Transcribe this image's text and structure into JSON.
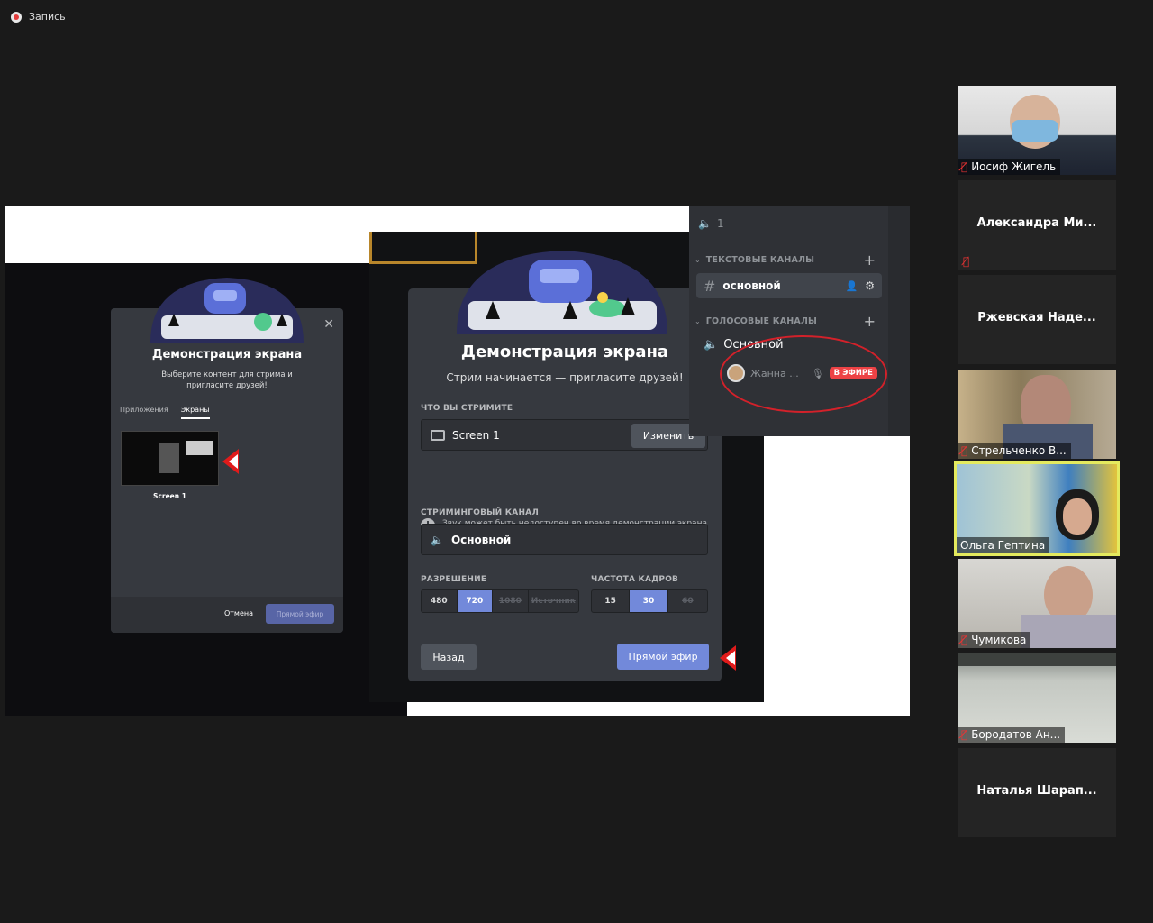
{
  "recording": {
    "label": "Запись"
  },
  "discord_small": {
    "title": "Демонстрация экрана",
    "subtitle": "Выберите контент для стрима и пригласите друзей!",
    "tabs": [
      "Приложения",
      "Экраны"
    ],
    "active_tab": "Экраны",
    "thumb_label": "Screen 1",
    "cancel": "Отмена",
    "go_live": "Прямой эфир"
  },
  "discord_big": {
    "title": "Демонстрация экрана",
    "subtitle": "Стрим начинается — пригласите друзей!",
    "stream_label": "ЧТО ВЫ СТРИМИТЕ",
    "stream_value": "Screen 1",
    "change": "Изменить",
    "warning": "Звук может быть недоступен во время демонстрации экрана устройства.",
    "channel_label": "СТРИМИНГОВЫЙ КАНАЛ",
    "channel_value": "Основной",
    "resolution_label": "РАЗРЕШЕНИЕ",
    "resolutions": [
      "480",
      "720",
      "1080",
      "Источник"
    ],
    "fps_label": "ЧАСТОТА КАДРОВ",
    "fps": [
      "15",
      "30",
      "60"
    ],
    "back": "Назад",
    "go_live": "Прямой эфир"
  },
  "discord_panel": {
    "voice_count": "1",
    "text_category": "ТЕКСТОВЫЕ КАНАЛЫ",
    "text_channel": "основной",
    "voice_category": "ГОЛОСОВЫЕ КАНАЛЫ",
    "voice_channel": "Основной",
    "user": "Жанна ...",
    "live_badge": "В ЭФИРЕ"
  },
  "participants": [
    {
      "name": "Иосиф Жигель",
      "muted": true,
      "video": true
    },
    {
      "name": "Александра  Ми...",
      "muted": true,
      "video": false
    },
    {
      "name": "Ржевская  Наде...",
      "muted": false,
      "video": false
    },
    {
      "name": "Стрельченко В...",
      "muted": true,
      "video": true
    },
    {
      "name": "Ольга Гептина",
      "muted": false,
      "video": true,
      "speaking": true
    },
    {
      "name": "Чумикова",
      "muted": true,
      "video": true
    },
    {
      "name": "Бородатов Ан...",
      "muted": true,
      "video": true
    },
    {
      "name": "Наталья  Шарап...",
      "muted": false,
      "video": false
    }
  ],
  "colors": {
    "accent": "#7289da",
    "live": "#ed4245",
    "speaker_border": "#e4ea5e",
    "annotation": "#d3212a"
  }
}
